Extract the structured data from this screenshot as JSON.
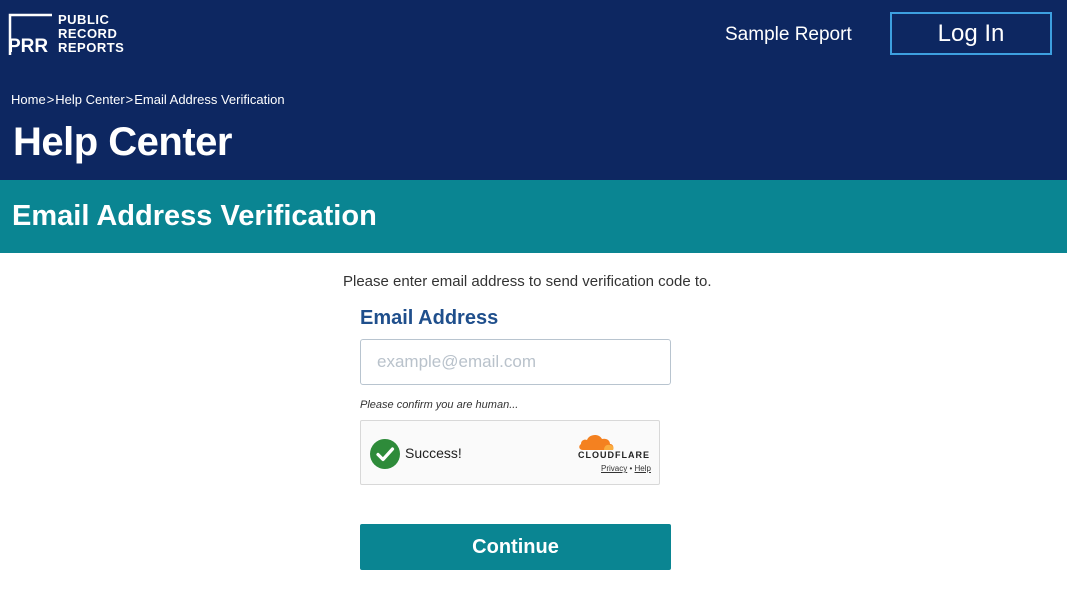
{
  "header": {
    "logo": {
      "name_lines": [
        "PUBLIC",
        "RECORD",
        "REPORTS"
      ],
      "abbrev": "PRR"
    },
    "nav": {
      "sample_report": "Sample Report",
      "login": "Log In"
    },
    "breadcrumb": {
      "items": [
        "Home",
        "Help Center",
        "Email Address Verification"
      ],
      "separator": ">"
    },
    "page_title": "Help Center"
  },
  "section": {
    "title": "Email Address Verification"
  },
  "form": {
    "instructions": "Please enter email address to send verification code to.",
    "email_label": "Email Address",
    "email_placeholder": "example@email.com",
    "email_value": "",
    "human_note": "Please confirm you are human...",
    "captcha": {
      "status": "Success!",
      "provider": "CLOUDFLARE",
      "privacy": "Privacy",
      "separator": "•",
      "help": "Help"
    },
    "continue_label": "Continue"
  },
  "colors": {
    "header_bg": "#0d2761",
    "section_bg": "#0a8592",
    "label": "#1f4f8c",
    "success_green": "#2e8b3a",
    "cloudflare_orange": "#f48120"
  }
}
